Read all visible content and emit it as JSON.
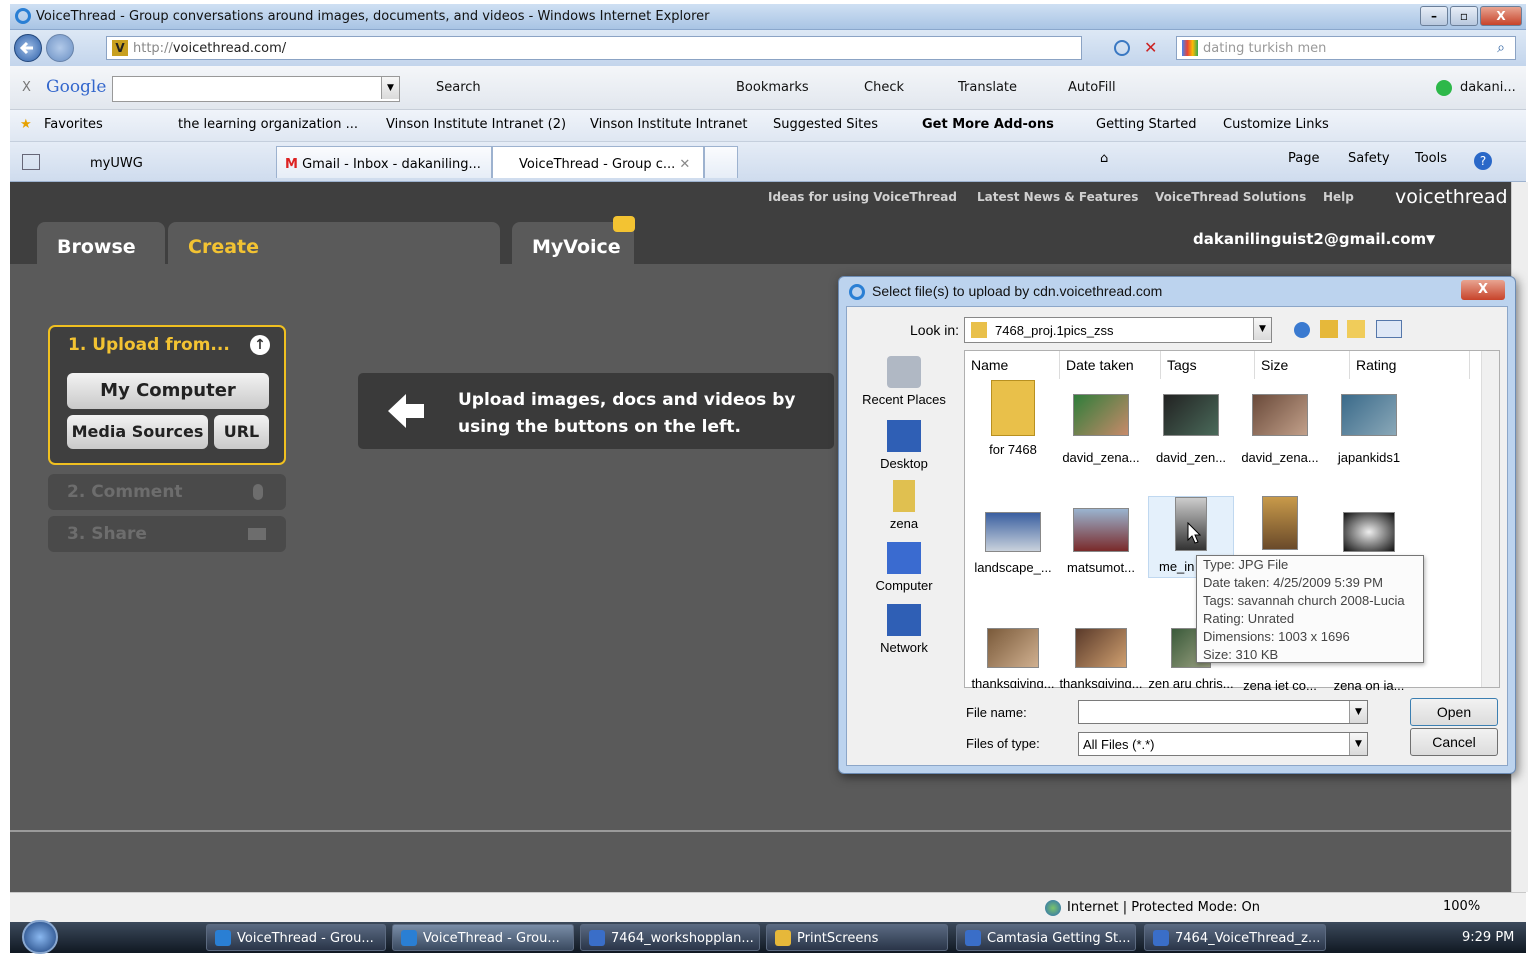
{
  "window": {
    "title": "VoiceThread - Group conversations around images, documents, and videos - Windows Internet Explorer",
    "minimize": "–",
    "maximize": "▫",
    "close": "X"
  },
  "address": {
    "url_prefix": "http://",
    "url_domain": "voicethread.com/",
    "search_value": "dating turkish men"
  },
  "google_toolbar": {
    "close": "X",
    "logo": "Google",
    "search": "Search",
    "bookmarks": "Bookmarks",
    "check": "Check",
    "translate": "Translate",
    "autofill": "AutoFill",
    "account": "dakani..."
  },
  "favorites": {
    "label": "Favorites",
    "links": [
      "the learning organization ...",
      "Vinson Institute Intranet (2)",
      "Vinson Institute Intranet",
      "Suggested Sites",
      "Get More Add-ons",
      "Getting Started",
      "Customize Links"
    ]
  },
  "tabs": [
    {
      "label": "myUWG"
    },
    {
      "label": "Gmail - Inbox - dakaniling..."
    },
    {
      "label": "VoiceThread - Group c..."
    }
  ],
  "commands": {
    "page": "Page",
    "safety": "Safety",
    "tools": "Tools"
  },
  "voicethread": {
    "top_links": [
      "Ideas for using VoiceThread",
      "Latest News & Features",
      "VoiceThread Solutions",
      "Help"
    ],
    "logo": "voicethread",
    "nav": {
      "browse": "Browse",
      "create": "Create",
      "myvoice": "MyVoice"
    },
    "email": "dakanilinguist2@gmail.com",
    "upload_header": "1. Upload from...",
    "my_computer": "My Computer",
    "media_sources": "Media Sources",
    "url": "URL",
    "step2": "2. Comment",
    "step3": "3. Share",
    "hint": "Upload images, docs and videos by using the buttons on the left."
  },
  "dialog": {
    "title": "Select file(s) to upload by cdn.voicethread.com",
    "close": "X",
    "look_in_label": "Look in:",
    "look_in_value": "7468_proj.1pics_zss",
    "columns": [
      "Name",
      "Date taken",
      "Tags",
      "Size",
      "Rating"
    ],
    "places": [
      "Recent Places",
      "Desktop",
      "zena",
      "Computer",
      "Network"
    ],
    "files": [
      "for 7468",
      "david_zena...",
      "david_zen...",
      "david_zena...",
      "japankids1",
      "landscape_...",
      "matsumot...",
      "me_in",
      "",
      "",
      "thanksgiving...",
      "thanksgiving...",
      "zen aru chris...",
      "zena jet co...",
      "zena on ja..."
    ],
    "tooltip": [
      "Type: JPG File",
      "Date taken: 4/25/2009 5:39 PM",
      "Tags: savannah church 2008-Lucia",
      "Rating: Unrated",
      "Dimensions: 1003 x 1696",
      "Size: 310 KB"
    ],
    "file_name_label": "File name:",
    "file_name_value": "",
    "files_of_type_label": "Files of type:",
    "files_of_type_value": "All Files (*.*)",
    "open": "Open",
    "cancel": "Cancel"
  },
  "status": {
    "zone": "Internet | Protected Mode: On",
    "zoom": "100%"
  },
  "taskbar": {
    "items": [
      "VoiceThread - Grou...",
      "VoiceThread - Grou...",
      "7464_workshopplan...",
      "PrintScreens",
      "Camtasia Getting St...",
      "7464_VoiceThread_z..."
    ],
    "clock": "9:29 PM"
  },
  "colors": {
    "accent": "#f3c332",
    "page_bg": "#5a5a5a",
    "header_bg": "#3f3f3f"
  }
}
